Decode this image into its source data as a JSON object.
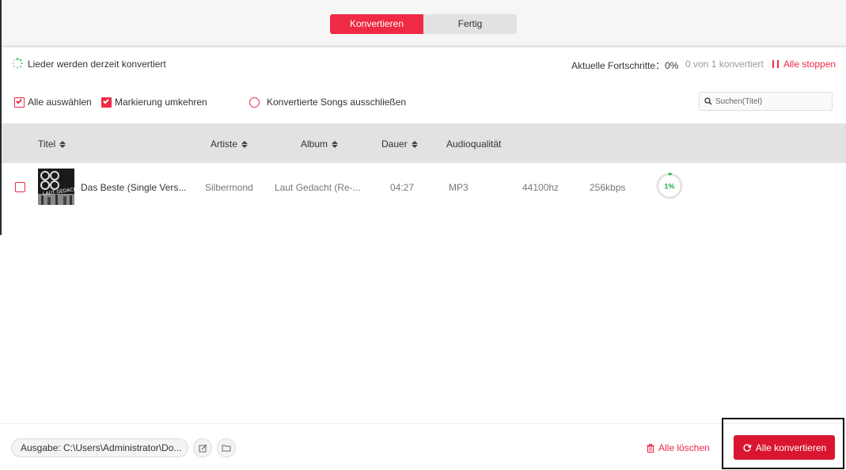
{
  "tabs": {
    "converting": "Konvertieren",
    "done": "Fertig"
  },
  "status": {
    "message": "Lieder werden derzeit konvertiert",
    "progress_label": "Aktuelle Fortschritte：0%",
    "progress_count": "0 von 1 konvertiert",
    "stop_all": "Alle stoppen"
  },
  "toolbar": {
    "select_all": "Alle auswählen",
    "invert_selection": "Markierung umkehren",
    "exclude_converted": "Konvertierte Songs ausschließen",
    "search_placeholder": "Suchen(Titel)"
  },
  "columns": {
    "title": "Titel",
    "artist": "Artiste",
    "album": "Album",
    "duration": "Dauer",
    "quality": "Audioqualität"
  },
  "songs": [
    {
      "cover_text": "LAUT GEDACHT",
      "title": "Das Beste (Single Vers...",
      "artist": "Silbermond",
      "album": "Laut Gedacht (Re-...",
      "duration": "04:27",
      "format": "MP3",
      "samplerate": "44100hz",
      "bitrate": "256kbps",
      "progress_label": "1%",
      "progress": 0.01
    }
  ],
  "footer": {
    "output": "Ausgabe: C:\\Users\\Administrator\\Do...",
    "delete_all": "Alle löschen",
    "convert_all": "Alle konvertieren"
  },
  "colors": {
    "accent": "#ee2a45",
    "button": "#d9152f",
    "progress": "#22b14c"
  }
}
